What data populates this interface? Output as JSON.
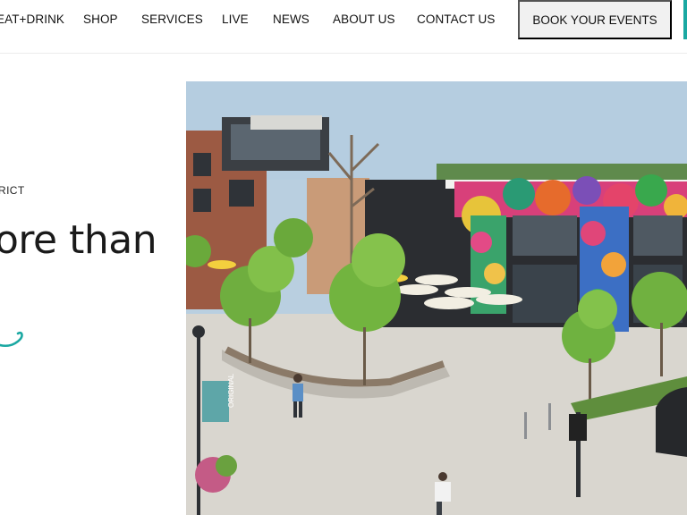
{
  "nav": {
    "items": [
      {
        "label": "EAT+DRINK"
      },
      {
        "label": "SHOP"
      },
      {
        "label": "SERVICES"
      },
      {
        "label": "LIVE"
      },
      {
        "label": "NEWS"
      },
      {
        "label": "ABOUT US"
      },
      {
        "label": "CONTACT US"
      }
    ],
    "cta_label": "BOOK YOUR EVENTS"
  },
  "hero": {
    "eyebrow": "RICT",
    "headline": "ore than",
    "banner_text": "ORIGINAL"
  },
  "colors": {
    "accent": "#1aa8a2",
    "button_bg": "#f1f1f1",
    "text": "#111111"
  }
}
